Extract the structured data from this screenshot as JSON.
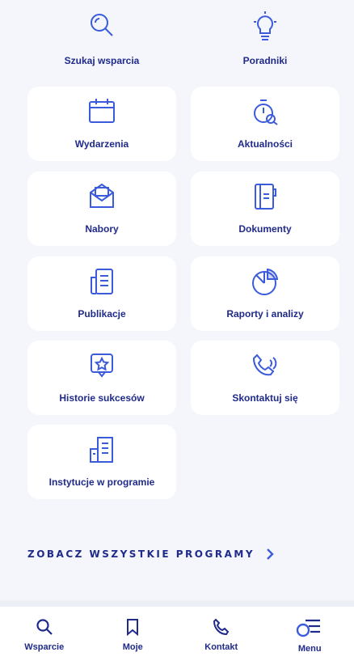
{
  "tiles": [
    {
      "label": "Szukaj wsparcia",
      "icon": "magnifier-icon"
    },
    {
      "label": "Poradniki",
      "icon": "lightbulb-icon"
    },
    {
      "label": "Wydarzenia",
      "icon": "calendar-icon"
    },
    {
      "label": "Aktualności",
      "icon": "stopwatch-icon"
    },
    {
      "label": "Nabory",
      "icon": "envelope-icon"
    },
    {
      "label": "Dokumenty",
      "icon": "document-icon"
    },
    {
      "label": "Publikacje",
      "icon": "publication-icon"
    },
    {
      "label": "Raporty i analizy",
      "icon": "pie-chart-icon"
    },
    {
      "label": "Historie sukcesów",
      "icon": "star-badge-icon"
    },
    {
      "label": "Skontaktuj się",
      "icon": "phone-icon"
    },
    {
      "label": "Instytucje w programie",
      "icon": "building-icon"
    }
  ],
  "all_programs_label": "ZOBACZ WSZYSTKIE PROGRAMY",
  "bottom_nav": [
    {
      "label": "Wsparcie",
      "icon": "search-icon"
    },
    {
      "label": "Moje",
      "icon": "bookmark-icon"
    },
    {
      "label": "Kontakt",
      "icon": "phone-icon"
    },
    {
      "label": "Menu",
      "icon": "menu-icon"
    }
  ],
  "colors": {
    "accent": "#1f2a8a",
    "icon": "#3b5bdb",
    "background": "#f4f6fb",
    "tile": "#ffffff"
  }
}
